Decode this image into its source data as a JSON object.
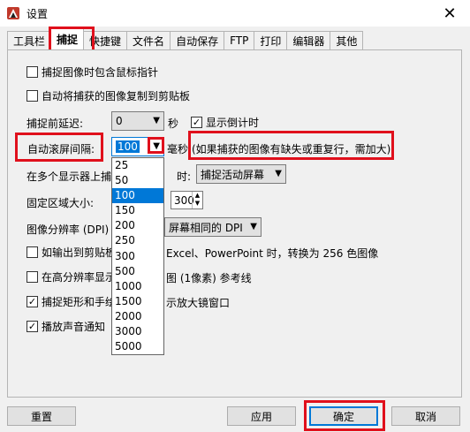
{
  "window": {
    "title": "设置",
    "close_glyph": "✕"
  },
  "tabs": [
    "工具栏",
    "捕捉",
    "快捷键",
    "文件名",
    "自动保存",
    "FTP",
    "打印",
    "编辑器",
    "其他"
  ],
  "active_tab": "捕捉",
  "capture": {
    "include_cursor": {
      "label": "捕捉图像时包含鼠标指针",
      "checked": false
    },
    "copy_to_clipboard": {
      "label": "自动将捕获的图像复制到剪贴板",
      "checked": false
    },
    "delay_label": "捕捉前延迟:",
    "delay_value": "0",
    "delay_unit": "秒",
    "show_countdown": {
      "label": "显示倒计时",
      "checked": true
    },
    "scroll_interval_label": "自动滚屏间隔:",
    "scroll_interval_value": "100",
    "scroll_interval_unit": "毫秒",
    "scroll_hint": "(如果捕获的图像有缺失或重复行，需加大)",
    "multi_monitor_label": "在多个显示器上捕",
    "multi_monitor_suffix": "时:",
    "multi_monitor_value": "捕捉活动屏幕",
    "fixed_region_label": "固定区域大小:",
    "fixed_region_value": "300",
    "dpi_label": "图像分辨率 (DPI)",
    "dpi_value": "屏幕相同的 DPI",
    "clipboard_256": {
      "label": "如输出到剪贴板",
      "suffix": "Excel、PowerPoint 时，转换为 256 色图像",
      "checked": false
    },
    "hires_ref": {
      "label": "在高分辨率显示",
      "suffix": "图 (1像素) 参考线",
      "checked": false
    },
    "magnifier": {
      "label": "捕捉矩形和手绘",
      "suffix": "示放大镜窗口",
      "checked": true
    },
    "sound": {
      "label": "播放声音通知",
      "checked": true
    }
  },
  "dropdown_options": [
    "25",
    "50",
    "100",
    "150",
    "200",
    "250",
    "300",
    "500",
    "1000",
    "1500",
    "2000",
    "3000",
    "5000"
  ],
  "dropdown_selected": "100",
  "buttons": {
    "reset": "重置",
    "apply": "应用",
    "ok": "确定",
    "cancel": "取消"
  },
  "colors": {
    "highlight": "#e0101c",
    "selection": "#0078d7"
  }
}
